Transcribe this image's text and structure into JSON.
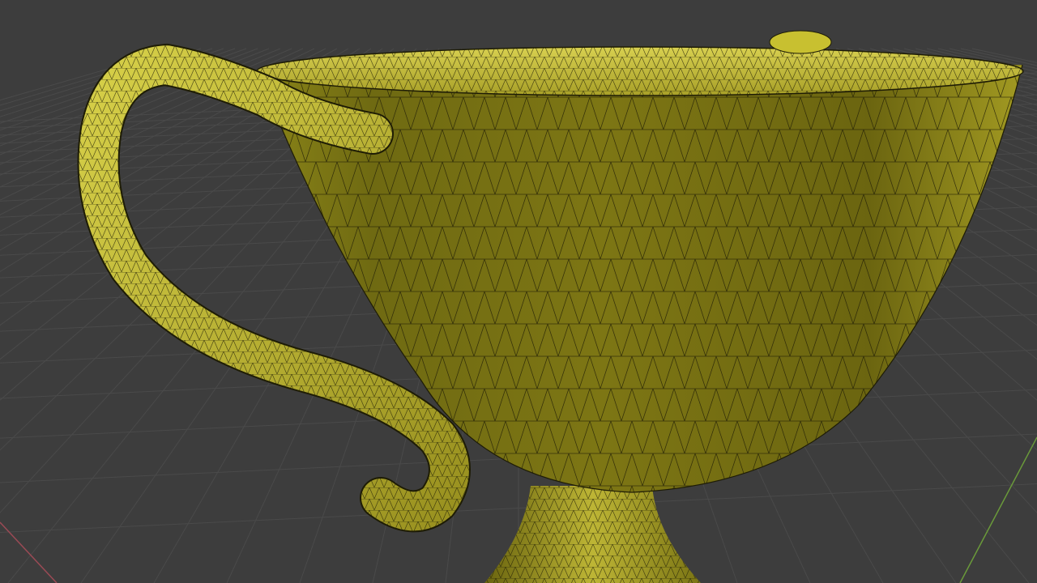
{
  "viewport": {
    "background_color": "#3d3d3d",
    "grid_color": "#4a4a4a",
    "x_axis_color": "#9a4a55",
    "y_axis_color": "#6a9a3a",
    "mesh_color": "#c8c030",
    "wire_color": "#1e1c05"
  },
  "object": {
    "icon": "teacup-mesh"
  }
}
